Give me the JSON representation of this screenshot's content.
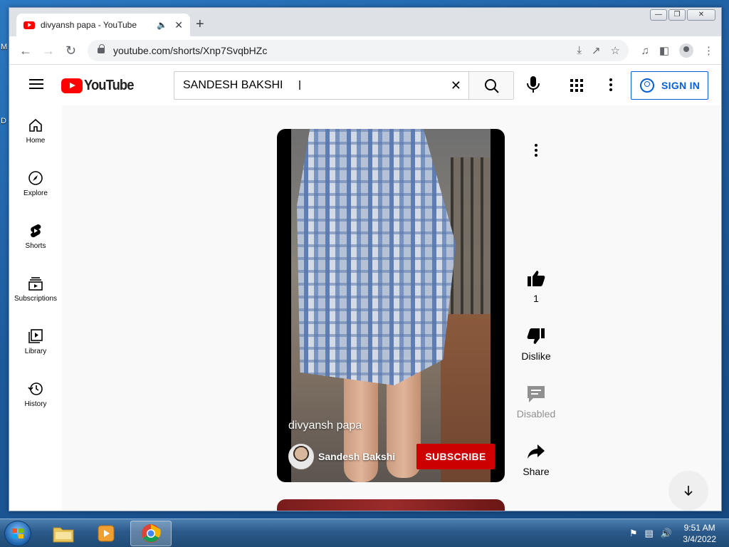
{
  "desktop": {
    "left_text_1": "M",
    "left_text_2": "D"
  },
  "browser": {
    "tab": {
      "title": "divyansh papa - YouTube"
    },
    "url": "youtube.com/shorts/Xnp7SvqbHZc"
  },
  "youtube": {
    "logo_text": "YouTube",
    "search": {
      "value": "SANDESH BAKSHI"
    },
    "signin_label": "SIGN IN",
    "guide": [
      {
        "label": "Home"
      },
      {
        "label": "Explore"
      },
      {
        "label": "Shorts"
      },
      {
        "label": "Subscriptions"
      },
      {
        "label": "Library"
      },
      {
        "label": "History"
      }
    ],
    "short": {
      "title": "divyansh papa",
      "channel": "Sandesh Bakshi",
      "subscribe_label": "SUBSCRIBE"
    },
    "actions": {
      "like_count": "1",
      "dislike_label": "Dislike",
      "comments_label": "Disabled",
      "share_label": "Share"
    }
  },
  "taskbar": {
    "time": "9:51 AM",
    "date": "3/4/2022"
  },
  "colors": {
    "youtube_red": "#ff0000",
    "subscribe_red": "#cc0000",
    "signin_blue": "#065fd4"
  }
}
